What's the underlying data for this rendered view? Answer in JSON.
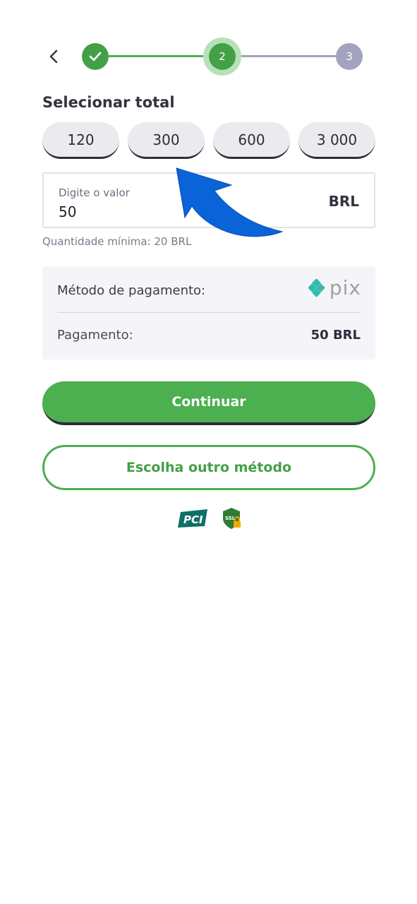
{
  "stepper": {
    "steps": [
      {
        "label": "✓",
        "state": "done"
      },
      {
        "label": "2",
        "state": "active"
      },
      {
        "label": "3",
        "state": "pending"
      }
    ]
  },
  "section_title": "Selecionar total",
  "amount_options": [
    "120",
    "300",
    "600",
    "3 000"
  ],
  "value_field": {
    "label": "Digite o valor",
    "value": "50",
    "currency": "BRL"
  },
  "min_quantity": "Quantidade mínima: 20 BRL",
  "payment": {
    "method_label": "Método de pagamento:",
    "method_logo_text": "pix",
    "amount_label": "Pagamento:",
    "amount_value": "50 BRL"
  },
  "buttons": {
    "continue": "Continuar",
    "other_method": "Escolha outro método"
  },
  "badges": {
    "pci": "PCI",
    "ssl": "SSL"
  },
  "colors": {
    "primary_green": "#4caf50",
    "step_pending": "#a3a3bd",
    "arrow_blue": "#0a63d8"
  }
}
